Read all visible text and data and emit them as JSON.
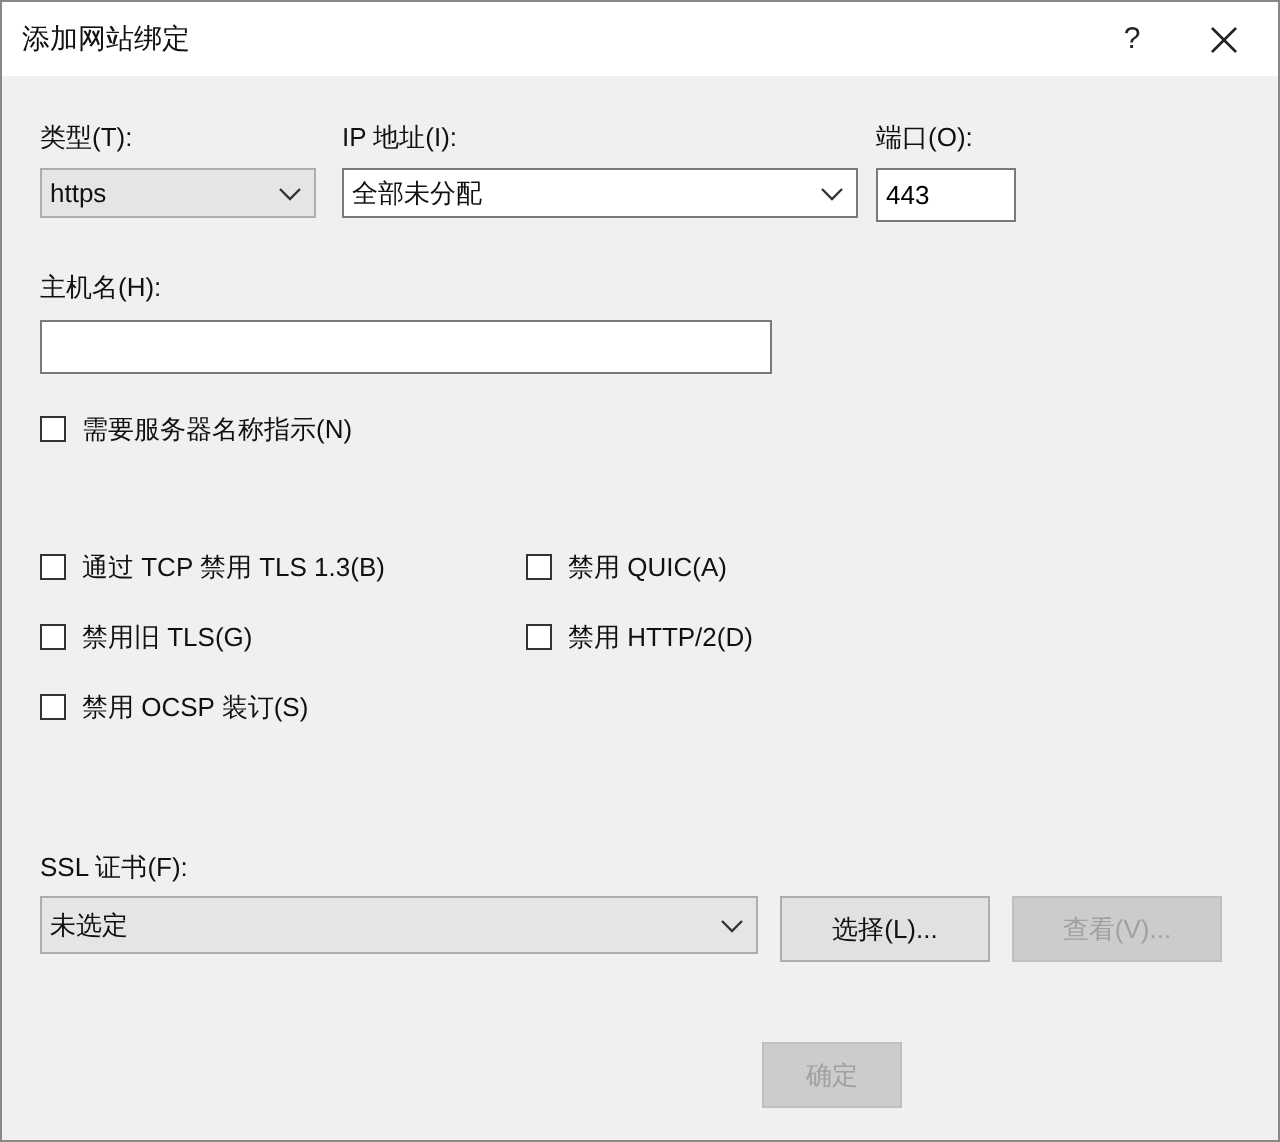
{
  "window": {
    "title": "添加网站绑定",
    "help_button": "?"
  },
  "binding": {
    "type": {
      "label": "类型(T):",
      "value": "https"
    },
    "ip": {
      "label": "IP 地址(I):",
      "value": "全部未分配"
    },
    "port": {
      "label": "端口(O):",
      "value": "443"
    },
    "host": {
      "label": "主机名(H):"
    },
    "sni": {
      "label": "需要服务器名称指示(N)",
      "checked": false
    }
  },
  "options": [
    {
      "label": "通过 TCP 禁用 TLS 1.3(B)",
      "checked": false
    },
    {
      "label": "禁用 QUIC(A)",
      "checked": false
    },
    {
      "label": "禁用旧 TLS(G)",
      "checked": false
    },
    {
      "label": "禁用 HTTP/2(D)",
      "checked": false
    },
    {
      "label": "禁用 OCSP 装订(S)",
      "checked": false
    }
  ],
  "ssl": {
    "label": "SSL 证书(F):",
    "value": "未选定",
    "buttons": [
      {
        "label": "选择(L)...",
        "disabled": false
      },
      {
        "label": "查看(V)...",
        "disabled": true
      }
    ]
  },
  "footer_buttons": [
    {
      "label": "确定",
      "disabled": true
    }
  ]
}
